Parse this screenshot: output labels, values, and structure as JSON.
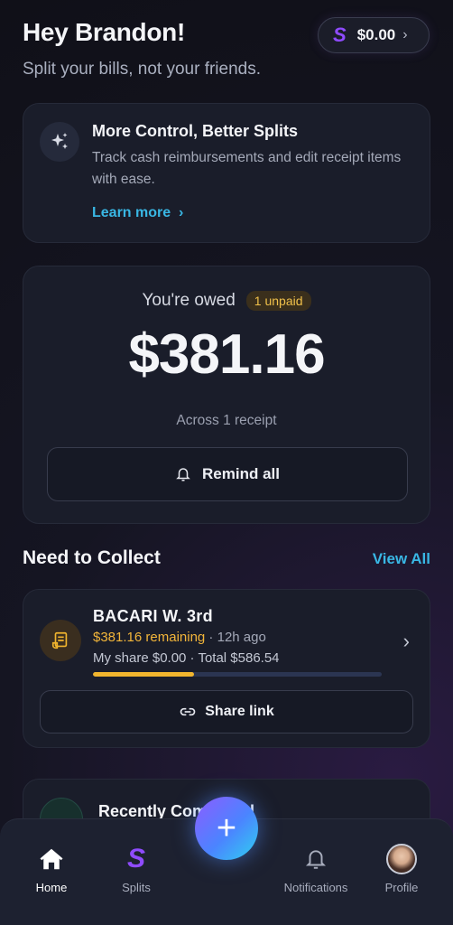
{
  "header": {
    "greeting": "Hey Brandon!",
    "tagline": "Split your bills, not your friends.",
    "balance": "$0.00",
    "balance_logo": "S"
  },
  "promo": {
    "title": "More Control, Better Splits",
    "description": "Track cash reimbursements and edit receipt items with ease.",
    "link": "Learn more",
    "icon": "sparkles-icon"
  },
  "owed": {
    "label": "You're owed",
    "badge": "1 unpaid",
    "amount": "$381.16",
    "subtext": "Across 1 receipt",
    "remind_label": "Remind all"
  },
  "collect": {
    "section_title": "Need to Collect",
    "view_all": "View All",
    "items": [
      {
        "name": "BACARI W. 3rd",
        "remaining": "$381.16 remaining",
        "time": " · 12h ago",
        "share_line": "My share $0.00 · Total $586.54",
        "progress": 0.35,
        "share_link_label": "Share link"
      }
    ]
  },
  "recent": {
    "title": "Recently Completed"
  },
  "tabs": [
    {
      "label": "Home",
      "icon": "home-icon",
      "active": true
    },
    {
      "label": "Splits",
      "icon": "splits-logo-icon",
      "active": false
    },
    {
      "label": "Notifications",
      "icon": "bell-icon",
      "active": false
    },
    {
      "label": "Profile",
      "icon": "avatar",
      "active": false
    }
  ],
  "fab": {
    "label": "+"
  },
  "colors": {
    "accent_blue": "#39b7e4",
    "accent_purple": "#8f4bff",
    "warning_yellow": "#f1b52e",
    "background": "#151522",
    "card": "#1a1d2a"
  }
}
